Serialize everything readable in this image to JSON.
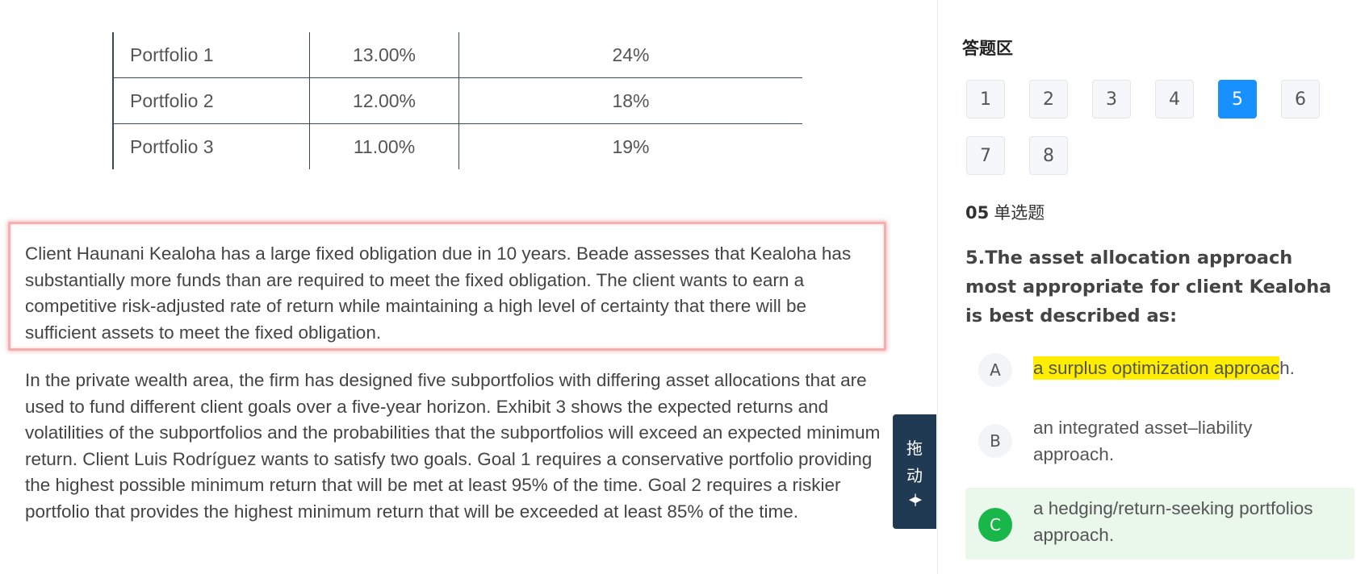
{
  "exhibit": {
    "rows": [
      {
        "name": "Portfolio 1",
        "col2": "13.00%",
        "col3": "24%"
      },
      {
        "name": "Portfolio 2",
        "col2": "12.00%",
        "col3": "18%"
      },
      {
        "name": "Portfolio 3",
        "col2": "11.00%",
        "col3": "19%"
      }
    ]
  },
  "passage": {
    "highlighted_paragraph": "Client Haunani Kealoha has a large fixed obligation due in 10 years. Beade assesses that Kealoha has substantially more funds than are required to meet the fixed obligation. The client wants to earn a competitive risk-adjusted rate of return while maintaining a high level of certainty that there will be sufficient assets to meet the fixed obligation.",
    "paragraph2": "In the private wealth area, the firm has designed five subportfolios with differing asset allocations that are used to fund different client goals over a five-year horizon. Exhibit 3 shows the expected returns and volatilities of the subportfolios and the probabilities that the subportfolios will exceed an expected minimum return. Client Luis Rodríguez wants to satisfy two goals. Goal 1 requires a conservative portfolio providing the highest possible minimum return that will be met at least 95% of the time. Goal 2 requires a riskier portfolio that provides the highest minimum return that will be exceeded at least 85% of the time."
  },
  "drag_handle": {
    "char1": "拖",
    "char2": "动",
    "arrows": "◂|▸"
  },
  "answer_panel": {
    "title": "答题区",
    "question_numbers": [
      "1",
      "2",
      "3",
      "4",
      "5",
      "6",
      "7",
      "8"
    ],
    "active_question": "5",
    "question_index": "05",
    "question_type": "单选题",
    "question_text": "5.The asset allocation approach most appropriate for client Kealoha is best described as:",
    "options": [
      {
        "letter": "A",
        "text": "a surplus optimization approac",
        "text_tail": "h."
      },
      {
        "letter": "B",
        "text": "an integrated asset–liability approach."
      },
      {
        "letter": "C",
        "text": "a hedging/return-seeking portfolios approach."
      }
    ],
    "colors": {
      "active_button": "#1890ff",
      "correct_badge": "#19b64a",
      "correct_background": "#e9f8eb",
      "highlight": "#ffee00",
      "drag_handle": "#1f3a52"
    }
  }
}
